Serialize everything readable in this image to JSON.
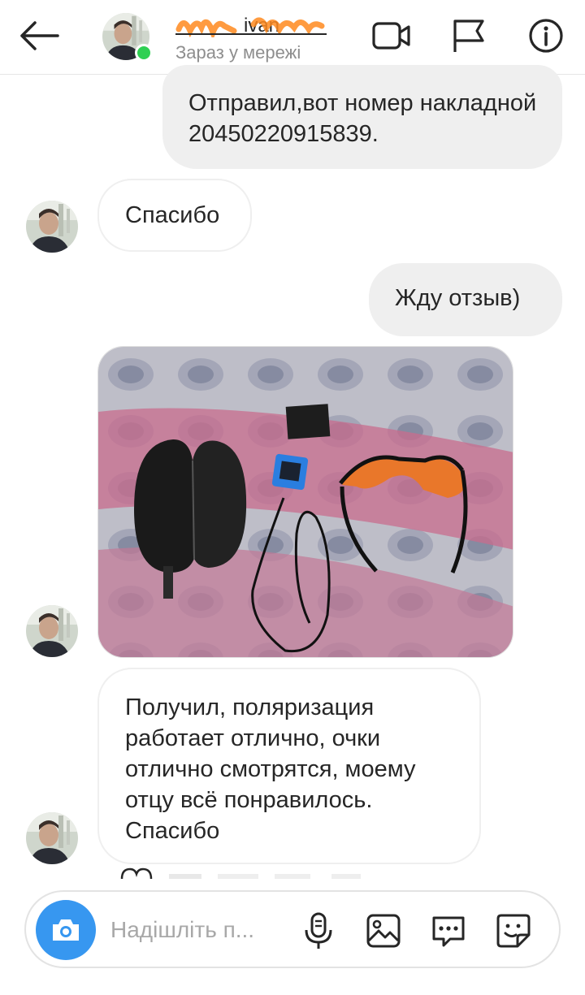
{
  "header": {
    "username": "ivan",
    "status": "Зараз у мережі"
  },
  "messages": [
    {
      "direction": "outgoing",
      "text": "Отправил,вот номер накладной 20450220915839."
    },
    {
      "direction": "incoming",
      "text": "Спасибо"
    },
    {
      "direction": "outgoing",
      "text": "Жду отзыв)"
    },
    {
      "direction": "incoming",
      "type": "photo"
    },
    {
      "direction": "incoming",
      "text": "Получил, поляризация работает отлично, очки отлично смотрятся, моему отцу всё понравилось. Спасибо"
    }
  ],
  "composer": {
    "placeholder": "Надішліть п..."
  },
  "colors": {
    "accent": "#3797f0",
    "online": "#2fd053",
    "outgoing_bubble": "#efefef"
  },
  "icons": [
    "back-arrow-icon",
    "video-call-icon",
    "flag-icon",
    "info-icon",
    "camera-icon",
    "microphone-icon",
    "gallery-icon",
    "chat-bubble-icon",
    "sticker-icon"
  ]
}
